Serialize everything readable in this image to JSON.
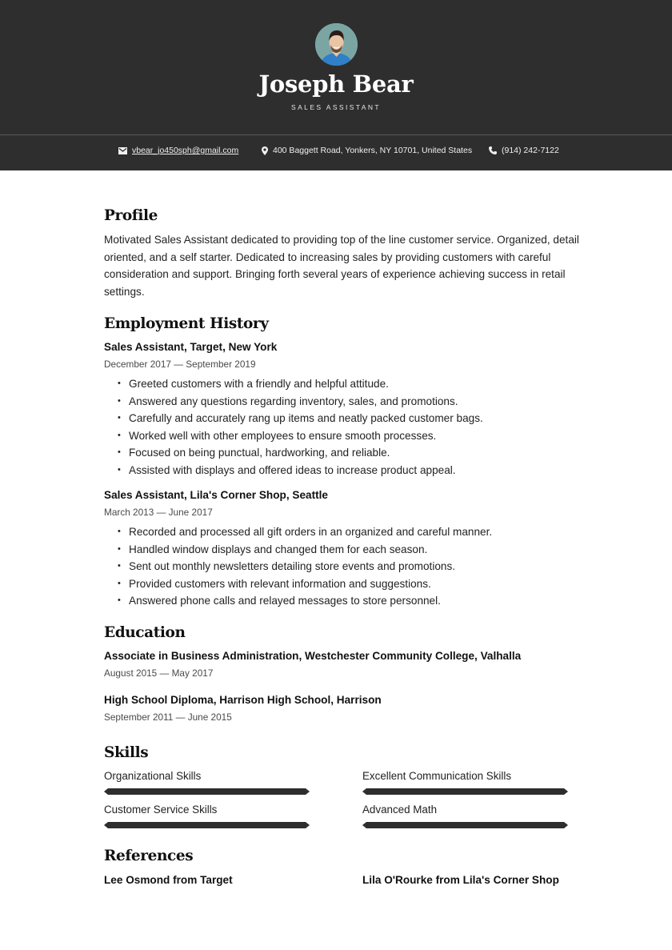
{
  "header": {
    "name": "Joseph Bear",
    "job_title": "SALES ASSISTANT",
    "avatar_icon": "profile-photo",
    "background_color": "#2e2e2e"
  },
  "contact": {
    "email": "vbear_jo450sph@gmail.com",
    "email_icon": "envelope-icon",
    "address": "400 Baggett Road, Yonkers, NY 10701, United States",
    "address_icon": "map-pin-icon",
    "phone": "(914) 242-7122",
    "phone_icon": "phone-icon"
  },
  "profile": {
    "title": "Profile",
    "lines": [
      "Motivated Sales Assistant dedicated to providing top of the line customer service. Organized, detail",
      "oriented, and a self starter. Dedicated to increasing sales by providing customers with careful",
      "consideration and support. Bringing forth several years of experience achieving success in retail",
      "settings."
    ]
  },
  "employment": {
    "title": "Employment History",
    "jobs": [
      {
        "heading": "Sales Assistant, Target, New York",
        "dates": "December 2017 — September 2019",
        "bullets": [
          "Greeted customers with a friendly and helpful attitude.",
          "Answered any questions regarding inventory, sales, and promotions.",
          "Carefully and accurately rang up items and neatly packed customer bags.",
          "Worked well with other employees to ensure smooth processes.",
          "Focused on being punctual, hardworking, and reliable.",
          "Assisted with displays and offered ideas to increase product appeal."
        ]
      },
      {
        "heading": "Sales Assistant, Lila's Corner Shop, Seattle",
        "dates": "March 2013 — June 2017",
        "bullets": [
          "Recorded and processed all gift orders in an organized and careful manner.",
          "Handled window displays and changed them for each season.",
          "Sent out monthly newsletters detailing store events and promotions.",
          "Provided customers with relevant information and suggestions.",
          "Answered phone calls and relayed messages to store personnel."
        ]
      }
    ]
  },
  "education": {
    "title": "Education",
    "items": [
      {
        "heading": "Associate in Business Administration, Westchester Community College, Valhalla",
        "dates": "August 2015 — May 2017"
      },
      {
        "heading": "High School Diploma, Harrison High School, Harrison",
        "dates": "September 2011 — June 2015"
      }
    ]
  },
  "skills": {
    "title": "Skills",
    "bar_color": "#2e2e2e",
    "items": [
      {
        "label": "Organizational Skills",
        "level": 1.0
      },
      {
        "label": "Excellent Communication Skills",
        "level": 1.0
      },
      {
        "label": "Customer Service Skills",
        "level": 1.0
      },
      {
        "label": "Advanced Math",
        "level": 1.0
      }
    ]
  },
  "references": {
    "title": "References",
    "items": [
      "Lee Osmond from Target",
      "Lila O'Rourke from Lila's Corner Shop"
    ]
  }
}
